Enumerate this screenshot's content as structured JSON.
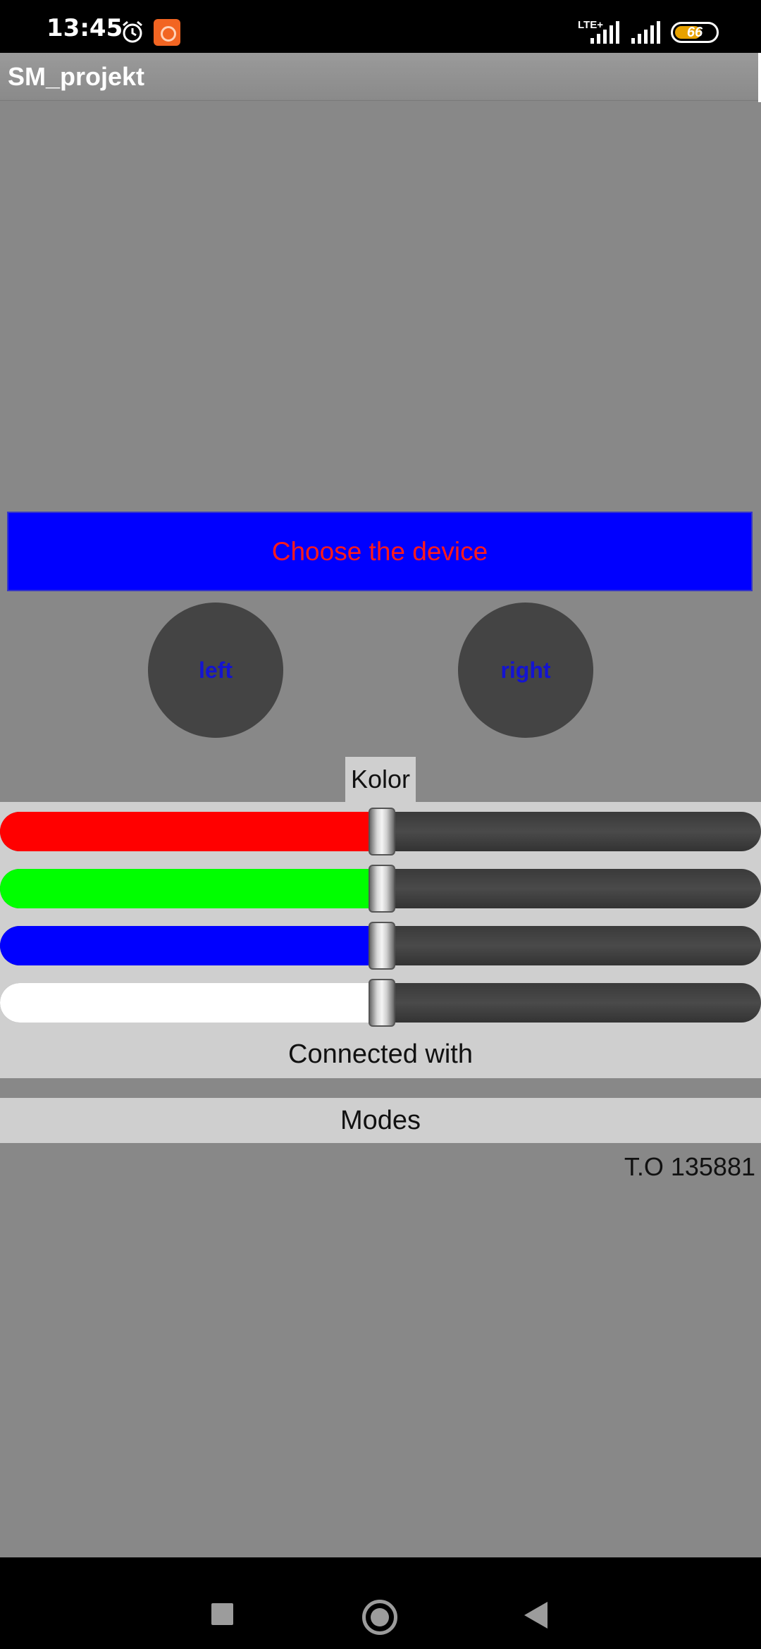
{
  "status_bar": {
    "time": "13:45",
    "network_type": "LTE+",
    "battery_level": 66,
    "battery_text": "66",
    "icons": [
      "alarm-icon",
      "app-notification-icon",
      "signal-icon",
      "signal-icon",
      "battery-icon"
    ]
  },
  "app_bar": {
    "title": "SM_projekt"
  },
  "device_button": {
    "label": "Choose the device",
    "bg_color": "#0000ff",
    "text_color": "#ff1a1a"
  },
  "round_buttons": {
    "left_label": "left",
    "right_label": "right"
  },
  "color_panel": {
    "label": "Kolor",
    "sliders": [
      {
        "name": "red",
        "color": "#ff0000",
        "value": 0.5
      },
      {
        "name": "green",
        "color": "#00ff00",
        "value": 0.5
      },
      {
        "name": "blue",
        "color": "#0000ff",
        "value": 0.5
      },
      {
        "name": "white",
        "color": "#ffffff",
        "value": 0.5
      }
    ]
  },
  "connection": {
    "label": "Connected with"
  },
  "modes": {
    "label": "Modes"
  },
  "footer": {
    "author": "T.O 135881"
  },
  "nav_bar": {
    "icons": [
      "recents-icon",
      "home-icon",
      "back-icon"
    ]
  }
}
